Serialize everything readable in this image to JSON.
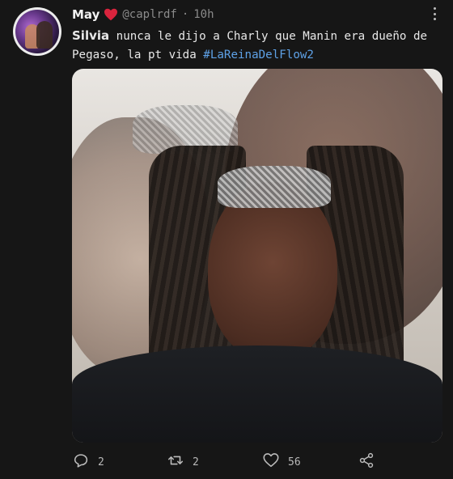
{
  "tweet": {
    "author_name": "May",
    "handle": "@caplrdf",
    "separator": "·",
    "time": "10h",
    "text_bold": "Silvia",
    "text_line1": " nunca le dijo a Charly que Manin era dueño de",
    "text_line2": "Pegaso, la pt vida ",
    "hashtag": "#LaReinaDelFlow2"
  },
  "actions": {
    "reply_count": "2",
    "retweet_count": "2",
    "like_count": "56"
  },
  "icons": {
    "name_badge": "heart-icon",
    "more": "more-vertical-icon",
    "reply": "reply-icon",
    "retweet": "retweet-icon",
    "like": "like-icon",
    "share": "share-icon"
  },
  "colors": {
    "background": "#161616",
    "text": "#e8e8e8",
    "muted": "#8b8b8b",
    "hashtag": "#5ea1e6",
    "heart": "#d9243d"
  }
}
